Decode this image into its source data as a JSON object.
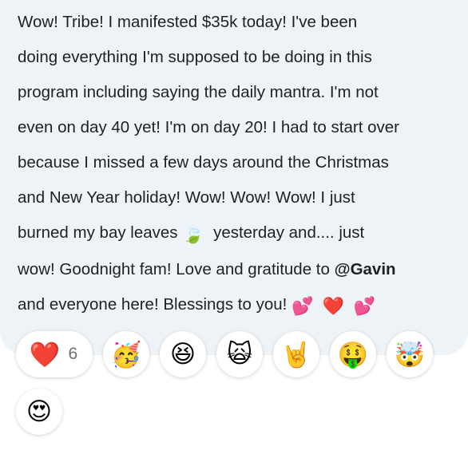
{
  "message": {
    "line1": "Wow! Tribe! I manifested $35k today! I've been",
    "line2": "doing everything I'm supposed to be doing in this",
    "line3": "program including saying the daily mantra. I'm not",
    "line4": "even on day 40 yet! I'm on day 20! I had to start over",
    "line5": "because I missed a few days around the Christmas",
    "line6": "and New Year holiday! Wow! Wow! Wow! I just",
    "line7_before": "burned my bay leaves ",
    "line7_emoji": "🍃",
    "line7_after": "  yesterday and.... just",
    "line8_before": "wow! Goodnight fam! Love and gratitude to ",
    "mention": "@Gavin",
    "line9_text": "and everyone here! Blessings to you! ",
    "line9_emojis": [
      "💕",
      "❤️",
      "💕"
    ]
  },
  "reactions": [
    {
      "icon": "heart-icon",
      "emoji": "❤️",
      "count": "6"
    },
    {
      "icon": "party-face-icon",
      "emoji": "🥳"
    },
    {
      "icon": "laughing-face-icon",
      "emoji": "😆"
    },
    {
      "icon": "screaming-cat-icon",
      "emoji": "🙀"
    },
    {
      "icon": "rock-on-hand-icon",
      "emoji": "🤘"
    },
    {
      "icon": "money-mouth-face-icon",
      "emoji": "🤑"
    },
    {
      "icon": "exploding-head-icon",
      "emoji": "🤯"
    },
    {
      "icon": "heart-eyes-face-icon",
      "emoji": "😍"
    }
  ],
  "colors": {
    "bubble_bg": "#eef3f7",
    "text": "#1e2124",
    "count": "#6b6e72"
  }
}
